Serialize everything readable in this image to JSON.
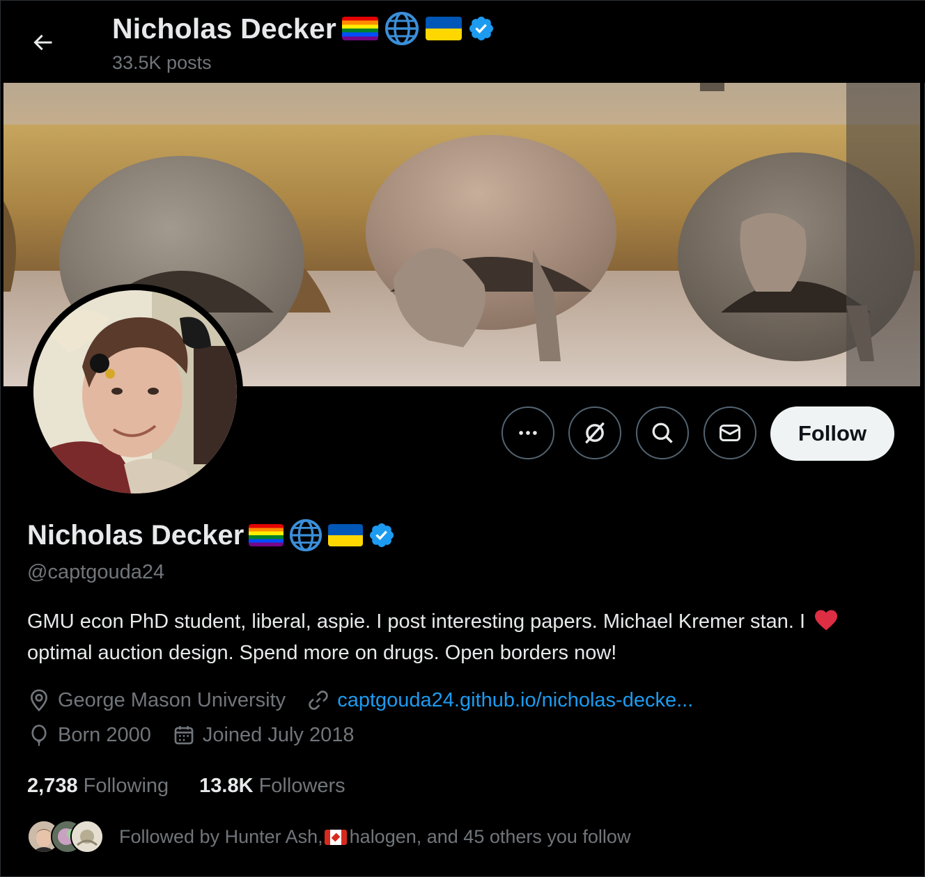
{
  "header": {
    "name": "Nicholas Decker",
    "posts": "33.5K posts"
  },
  "actions": {
    "more_icon": "more-horizontal-icon",
    "grok_icon": "grok-icon",
    "search_icon": "search-icon",
    "message_icon": "mail-icon",
    "follow_label": "Follow"
  },
  "profile": {
    "name": "Nicholas Decker",
    "badges": [
      "pride-flag-emoji",
      "globe-emoji",
      "ukraine-flag-emoji",
      "verified-badge"
    ],
    "handle": "@captgouda24",
    "bio_part1": "GMU econ PhD student, liberal, aspie. I post interesting papers. Michael Kremer stan. I",
    "bio_part2": "optimal auction design. Spend more on drugs. Open borders now!",
    "location": "George Mason University",
    "website": "captgouda24.github.io/nicholas-decke...",
    "birth": "Born 2000",
    "joined": "Joined July 2018"
  },
  "stats": {
    "following_count": "2,738",
    "following_label": "Following",
    "followers_count": "13.8K",
    "followers_label": "Followers"
  },
  "followed_by": {
    "prefix": "Followed by Hunter Ash,",
    "suffix": "halogen, and 45 others you follow"
  },
  "colors": {
    "background": "#000000",
    "text_primary": "#e7e9ea",
    "text_secondary": "#71767b",
    "link": "#1d9bf0",
    "verified": "#1d9bf0",
    "button_border": "#536471",
    "follow_bg": "#eff3f4"
  }
}
